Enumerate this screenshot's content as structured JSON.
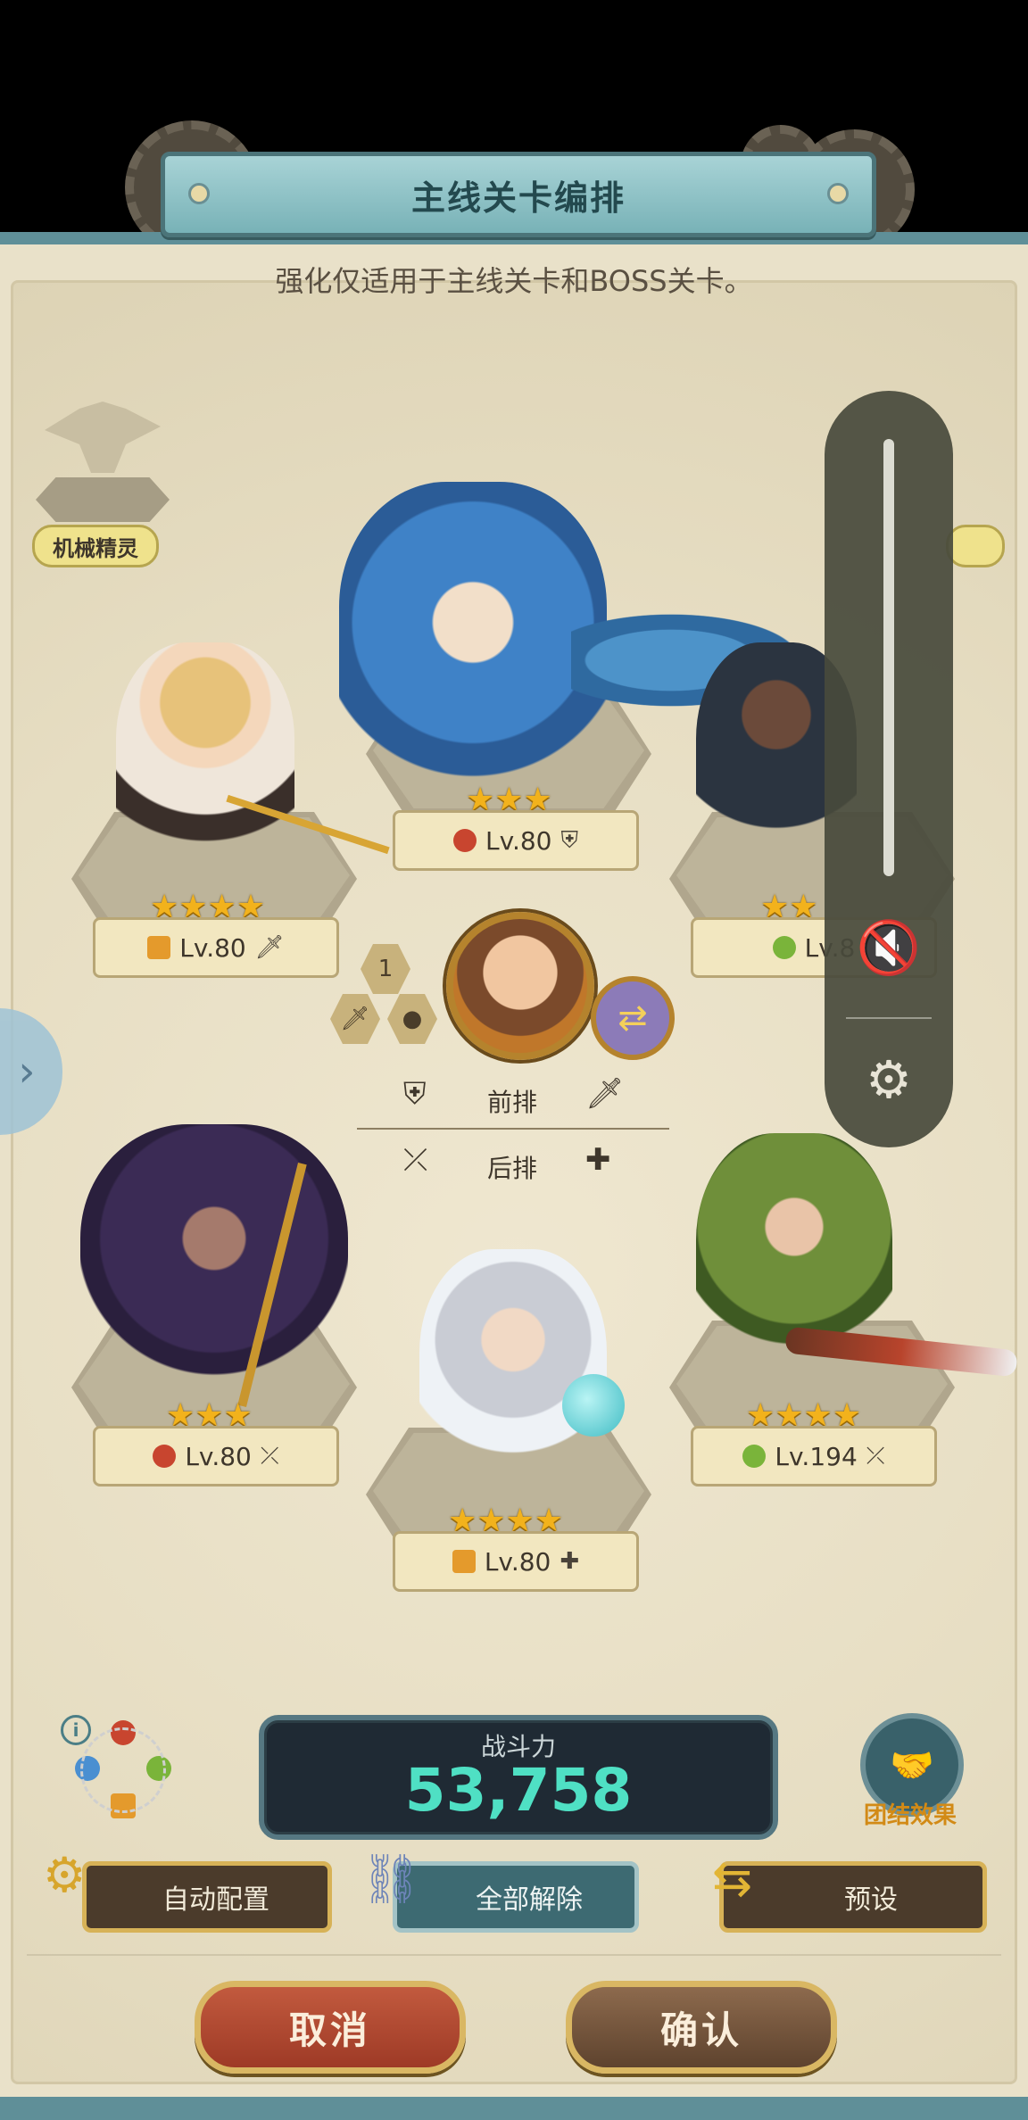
{
  "header": {
    "title": "主线关卡编排",
    "subtitle": "强化仅适用于主线关卡和BOSS关卡。"
  },
  "side_labels": {
    "left": "机械精灵"
  },
  "heroes": [
    {
      "id": "top-center",
      "stars": "★★★",
      "level": "Lv.80",
      "element": "fire",
      "role": "shield-icon"
    },
    {
      "id": "top-left",
      "stars": "★★★★",
      "level": "Lv.80",
      "element": "earth",
      "role": "sword-icon"
    },
    {
      "id": "top-right",
      "stars": "★★",
      "level": "Lv.8",
      "element": "wind",
      "role": ""
    },
    {
      "id": "bottom-left",
      "stars": "★★★",
      "level": "Lv.80",
      "element": "fire",
      "role": "bow-icon"
    },
    {
      "id": "bottom-center",
      "stars": "★★★★",
      "level": "Lv.80",
      "element": "earth",
      "role": "heal-icon"
    },
    {
      "id": "bottom-right",
      "stars": "★★★★",
      "level": "Lv.194",
      "element": "wind",
      "role": "bow-icon"
    }
  ],
  "formation": {
    "slot_number": "1",
    "front_row": "前排",
    "back_row": "后排"
  },
  "power": {
    "label": "战斗力",
    "value": "53,758"
  },
  "unity": {
    "label": "团结效果"
  },
  "actions": {
    "auto": "自动配置",
    "release_all": "全部解除",
    "preset": "预设"
  },
  "footer": {
    "cancel": "取消",
    "confirm": "确认"
  },
  "colors": {
    "panel_bg": "#e9e1c9",
    "teal": "#5f8f98",
    "power_value": "#4fe0c4",
    "fire": "#c8452f",
    "earth": "#e49a2c",
    "wind": "#7ab43a",
    "water": "#4a8fd1"
  }
}
